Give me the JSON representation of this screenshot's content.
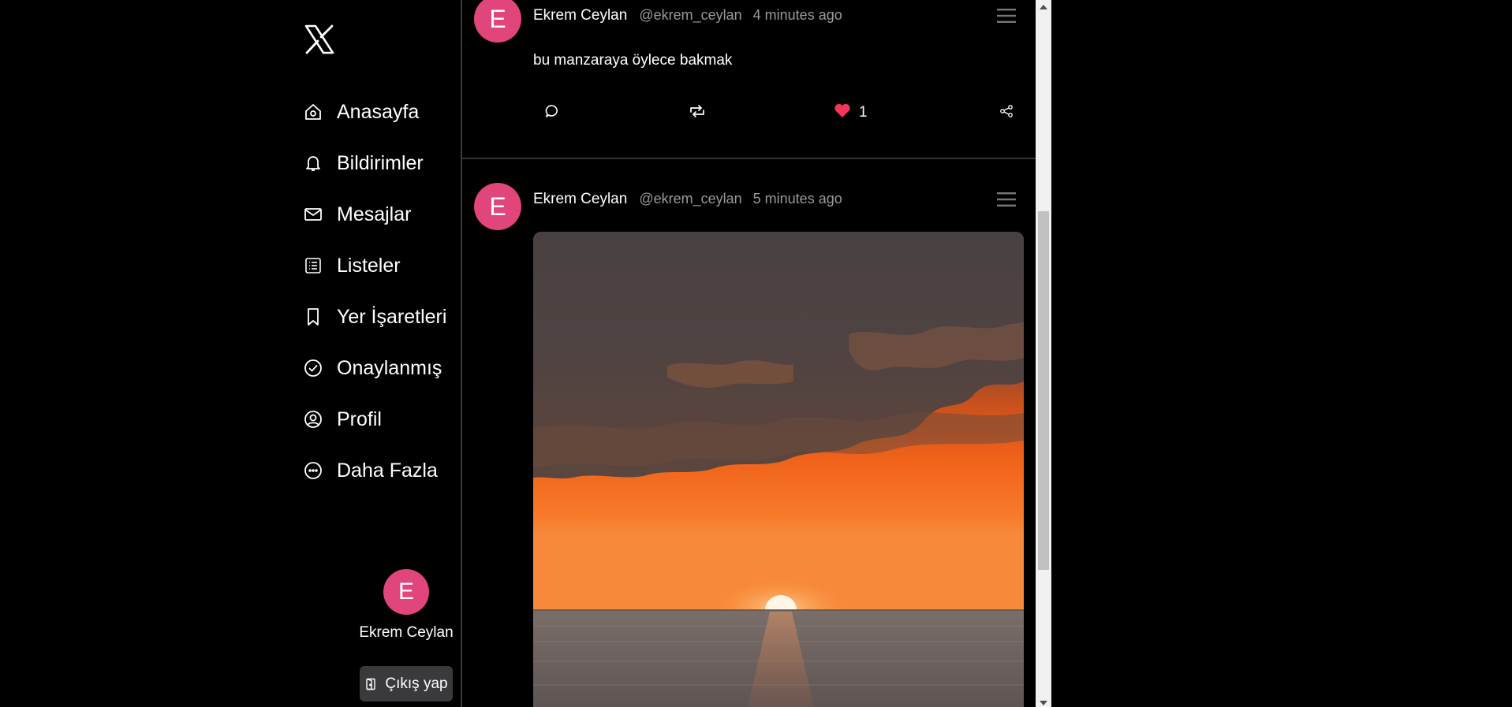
{
  "sidebar": {
    "logo_icon": "x-logo-icon",
    "items": [
      {
        "label": "Anasayfa",
        "icon": "home-icon"
      },
      {
        "label": "Bildirimler",
        "icon": "bell-icon"
      },
      {
        "label": "Mesajlar",
        "icon": "envelope-icon"
      },
      {
        "label": "Listeler",
        "icon": "list-icon"
      },
      {
        "label": "Yer İşaretleri",
        "icon": "bookmark-icon"
      },
      {
        "label": "Onaylanmış",
        "icon": "check-circle-icon"
      },
      {
        "label": "Profil",
        "icon": "person-circle-icon"
      },
      {
        "label": "Daha Fazla",
        "icon": "more-circle-icon"
      }
    ],
    "user": {
      "initial": "E",
      "name": "Ekrem Ceylan"
    },
    "logout_label": "Çıkış yap"
  },
  "feed": {
    "posts": [
      {
        "initial": "E",
        "name": "Ekrem Ceylan",
        "handle": "@ekrem_ceylan",
        "time": "4 minutes ago",
        "text": "bu manzaraya öylece bakmak",
        "likes": "1",
        "liked": true
      },
      {
        "initial": "E",
        "name": "Ekrem Ceylan",
        "handle": "@ekrem_ceylan",
        "time": "5 minutes ago",
        "image": "sunset-over-sea"
      }
    ]
  },
  "colors": {
    "background": "#000000",
    "avatar": "#e0457b",
    "muted_text": "#9a9a9a",
    "like": "#f4365a",
    "logout_button": "#3a3a3d"
  }
}
